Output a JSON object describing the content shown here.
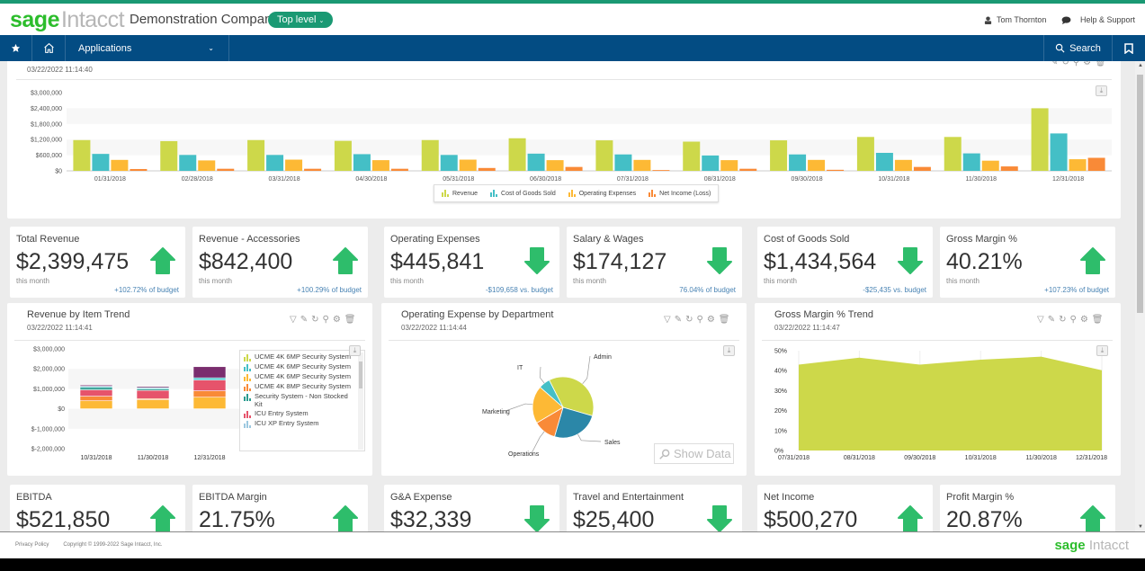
{
  "header": {
    "logo_sage": "sage",
    "logo_intacct": "Intacct",
    "company": "Demonstration Company",
    "level_button": "Top level",
    "user_name": "Tom Thornton",
    "help": "Help & Support"
  },
  "nav": {
    "applications": "Applications",
    "search": "Search"
  },
  "top_chart": {
    "date": "03/22/2022 11:14:40",
    "chart_data": {
      "type": "bar",
      "title": "",
      "categories": [
        "01/31/2018",
        "02/28/2018",
        "03/31/2018",
        "04/30/2018",
        "05/31/2018",
        "06/30/2018",
        "07/31/2018",
        "08/31/2018",
        "09/30/2018",
        "10/31/2018",
        "11/30/2018",
        "12/31/2018"
      ],
      "series": [
        {
          "name": "Revenue",
          "color": "#cdd84a",
          "values": [
            1180000,
            1140000,
            1180000,
            1150000,
            1180000,
            1250000,
            1170000,
            1120000,
            1170000,
            1300000,
            1300000,
            2400000
          ]
        },
        {
          "name": "Cost of Goods Sold",
          "color": "#44bfc6",
          "values": [
            650000,
            610000,
            610000,
            640000,
            610000,
            660000,
            630000,
            590000,
            630000,
            690000,
            670000,
            1434564
          ]
        },
        {
          "name": "Operating Expenses",
          "color": "#fdb935",
          "values": [
            420000,
            400000,
            430000,
            410000,
            430000,
            410000,
            420000,
            410000,
            420000,
            420000,
            390000,
            445841
          ]
        },
        {
          "name": "Net Income (Loss)",
          "color": "#f98a37",
          "values": [
            70000,
            80000,
            80000,
            80000,
            110000,
            150000,
            30000,
            80000,
            40000,
            150000,
            170000,
            500270
          ]
        }
      ],
      "yticks": [
        "$0",
        "$600,000",
        "$1,200,000",
        "$1,800,000",
        "$2,400,000",
        "$3,000,000"
      ],
      "ylim": [
        0,
        3000000
      ],
      "grid": true,
      "legend": "bottom-center"
    }
  },
  "kpis_row1": [
    {
      "title": "Total Revenue",
      "value": "$2,399,475",
      "sub": "this month",
      "budget": "+102.72% of budget",
      "trend": "up"
    },
    {
      "title": "Revenue - Accessories",
      "value": "$842,400",
      "sub": "this month",
      "budget": "+100.29% of budget",
      "trend": "up"
    },
    {
      "title": "Operating Expenses",
      "value": "$445,841",
      "sub": "this month",
      "budget": "-$109,658 vs. budget",
      "trend": "down"
    },
    {
      "title": "Salary & Wages",
      "value": "$174,127",
      "sub": "this month",
      "budget": "76.04% of budget",
      "trend": "down"
    },
    {
      "title": "Cost of Goods Sold",
      "value": "$1,434,564",
      "sub": "this month",
      "budget": "-$25,435 vs. budget",
      "trend": "down"
    },
    {
      "title": "Gross Margin %",
      "value": "40.21%",
      "sub": "this month",
      "budget": "+107.23% of budget",
      "trend": "up"
    }
  ],
  "revenue_item_trend": {
    "title": "Revenue by Item Trend",
    "date": "03/22/2022 11:14:41",
    "chart_data": {
      "type": "bar",
      "stacked": true,
      "categories": [
        "10/31/2018",
        "11/30/2018",
        "12/31/2018"
      ],
      "yticks": [
        "$-2,000,000",
        "$-1,000,000",
        "$0",
        "$1,000,000",
        "$2,000,000",
        "$3,000,000"
      ],
      "ylim": [
        -2000000,
        3000000
      ],
      "series": [
        {
          "name": "UCME 4K 6MP Security System (3)",
          "color": "#fdb935",
          "values": [
            400000,
            450000,
            580000
          ]
        },
        {
          "name": "UCME 4K 8MP Security System",
          "color": "#f98a37",
          "values": [
            230000,
            60000,
            320000
          ]
        },
        {
          "name": "ICU Entry System",
          "color": "#e6536b",
          "values": [
            320000,
            410000,
            540000
          ]
        },
        {
          "name": "Security System - Non Stocked Kit",
          "color": "#2a9b8f",
          "values": [
            120000,
            70000,
            0
          ]
        },
        {
          "name": "UCME 4K 6MP Security System (2)",
          "color": "#44bfc6",
          "values": [
            60000,
            60000,
            110000
          ]
        },
        {
          "name": "ICU XP Entry System",
          "color": "#7a2e6e",
          "values": [
            60000,
            60000,
            560000
          ]
        }
      ],
      "legend_items": [
        {
          "label": "UCME 4K 6MP Security System",
          "color": "#cdd84a"
        },
        {
          "label": "UCME 4K 6MP Security System",
          "color": "#44bfc6"
        },
        {
          "label": "UCME 4K 6MP Security System",
          "color": "#fdb935"
        },
        {
          "label": "UCME 4K 8MP Security System",
          "color": "#f98a37"
        },
        {
          "label": "Security System - Non Stocked Kit",
          "color": "#2a9b8f"
        },
        {
          "label": "ICU Entry System",
          "color": "#e6536b"
        },
        {
          "label": "ICU XP Entry System",
          "color": "#9cc8e0"
        }
      ],
      "legend": "right"
    }
  },
  "opex_department": {
    "title": "Operating Expense by Department",
    "date": "03/22/2022 11:14:44",
    "show_data": "Show Data",
    "chart_data": {
      "type": "pie",
      "slices": [
        {
          "label": "Admin",
          "value": 37,
          "color": "#cdd84a"
        },
        {
          "label": "Sales",
          "value": 25,
          "color": "#2b87a8"
        },
        {
          "label": "Operations",
          "value": 12,
          "color": "#f98a37"
        },
        {
          "label": "Marketing",
          "value": 20,
          "color": "#fdb935"
        },
        {
          "label": "IT",
          "value": 6,
          "color": "#44bfc6"
        }
      ]
    }
  },
  "gross_margin_trend": {
    "title": "Gross Margin % Trend",
    "date": "03/22/2022 11:14:47",
    "chart_data": {
      "type": "area",
      "x": [
        "07/31/2018",
        "08/31/2018",
        "09/30/2018",
        "10/31/2018",
        "11/30/2018",
        "12/31/2018"
      ],
      "values": [
        43,
        46.5,
        43,
        45.5,
        47,
        40.2
      ],
      "yticks": [
        "0%",
        "10%",
        "20%",
        "30%",
        "40%",
        "50%"
      ],
      "ylim": [
        0,
        50
      ],
      "color": "#cdd84a",
      "grid": true
    }
  },
  "kpis_row2": [
    {
      "title": "EBITDA",
      "value": "$521,850",
      "trend": "up"
    },
    {
      "title": "EBITDA Margin",
      "value": "21.75%",
      "trend": "up"
    },
    {
      "title": "G&A Expense",
      "value": "$32,339",
      "trend": "down"
    },
    {
      "title": "Travel and Entertainment",
      "value": "$25,400",
      "trend": "down"
    },
    {
      "title": "Net Income",
      "value": "$500,270",
      "trend": "up"
    },
    {
      "title": "Profit Margin %",
      "value": "20.87%",
      "trend": "up"
    }
  ],
  "footer": {
    "privacy": "Privacy Policy",
    "copyright": "Copyright © 1999-2022 Sage Intacct, Inc.",
    "logo_sage": "sage",
    "logo_intacct": "Intacct"
  },
  "colors": {
    "brand_green": "#2cbd2c",
    "teal": "#1a9973",
    "nav_blue": "#034c83",
    "arrow_green": "#2ebd6b"
  }
}
